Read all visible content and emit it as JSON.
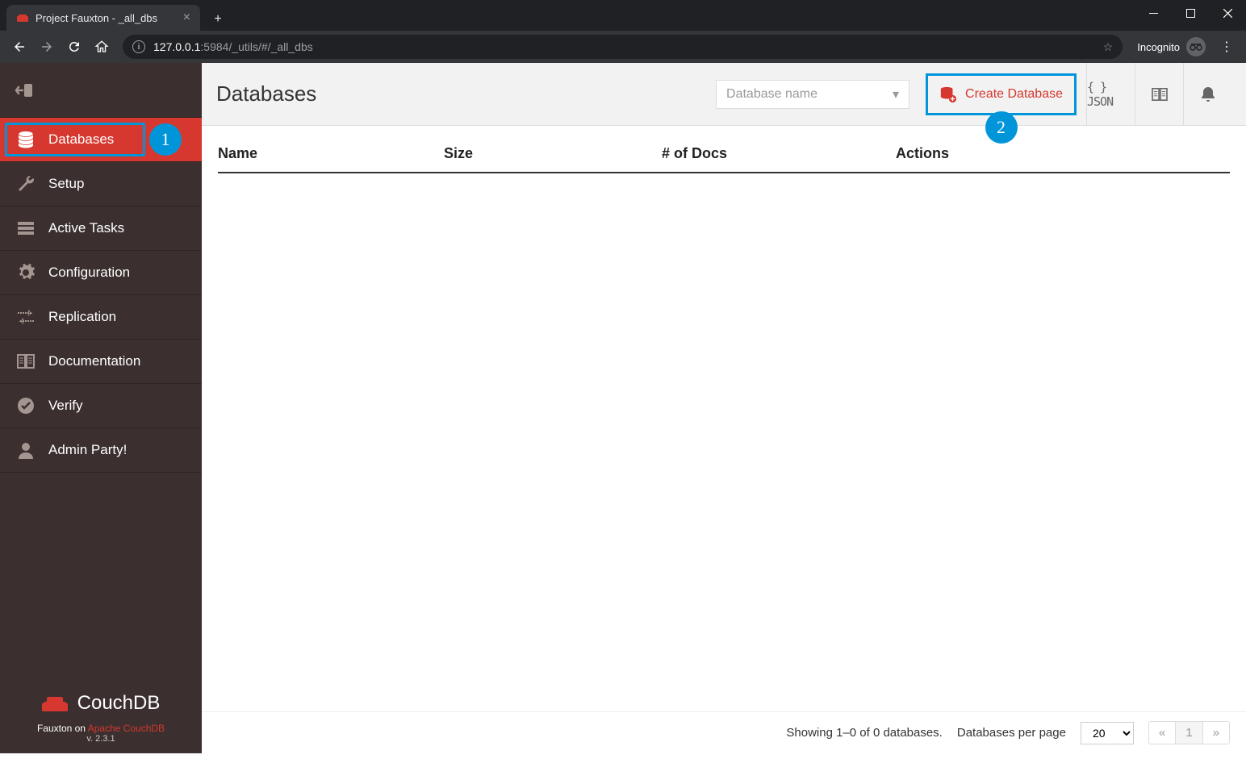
{
  "window": {
    "tab_title": "Project Fauxton - _all_dbs",
    "url_host": "127.0.0.1",
    "url_port": ":5984",
    "url_path": "/_utils/#/_all_dbs",
    "incognito_label": "Incognito"
  },
  "sidebar": {
    "items": [
      {
        "label": "Databases",
        "icon": "database-icon",
        "active": true,
        "badge": "1"
      },
      {
        "label": "Setup",
        "icon": "wrench-icon"
      },
      {
        "label": "Active Tasks",
        "icon": "tasks-icon"
      },
      {
        "label": "Configuration",
        "icon": "gear-icon"
      },
      {
        "label": "Replication",
        "icon": "replication-icon"
      },
      {
        "label": "Documentation",
        "icon": "book-icon"
      },
      {
        "label": "Verify",
        "icon": "check-circle-icon"
      },
      {
        "label": "Admin Party!",
        "icon": "user-icon"
      }
    ],
    "logo_text": "CouchDB",
    "footer_prefix": "Fauxton on ",
    "footer_link": "Apache CouchDB",
    "footer_version": "v. 2.3.1"
  },
  "header": {
    "title": "Databases",
    "search_placeholder": "Database name",
    "create_label": "Create Database",
    "create_badge": "2",
    "json_label": "{ } JSON"
  },
  "table": {
    "col_name": "Name",
    "col_size": "Size",
    "col_docs": "# of Docs",
    "col_actions": "Actions"
  },
  "footer": {
    "showing": "Showing 1–0 of 0 databases.",
    "per_page_label": "Databases per page",
    "per_page_value": "20",
    "prev": "«",
    "page": "1",
    "next": "»"
  }
}
